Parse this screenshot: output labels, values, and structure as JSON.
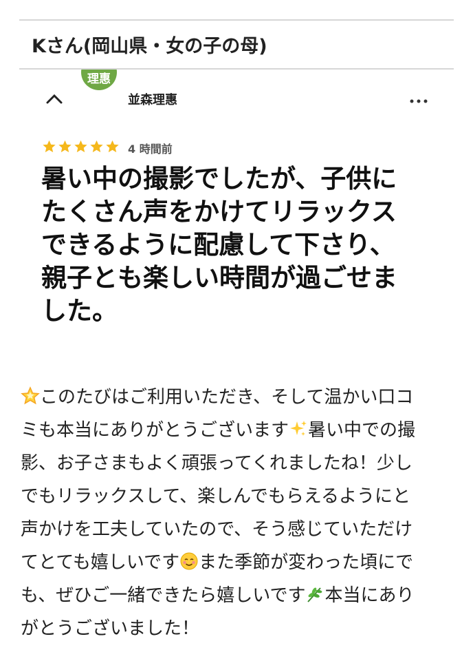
{
  "header": {
    "title": "Kさん(岡山県・女の子の母)"
  },
  "review_app": {
    "avatar_text": "理惠",
    "reviewer_name": "並森理惠",
    "icons": {
      "close": "close-icon",
      "more": "more-dots-icon"
    }
  },
  "review": {
    "rating": 5,
    "time_ago": "4 時間前",
    "lines": [
      "暑い中の撮影でしたが、子供に",
      "たくさん声をかけてリラックス",
      "できるように配慮して下さり、",
      "親子とも楽しい時間が過ごせま",
      "した。"
    ]
  },
  "reply": {
    "line1": "このたびはご利用いただき、そして温かい口コ",
    "line2_a": "ミも本当にありがとうございます",
    "line2_b": "暑い中での撮",
    "line3": "影、お子さまもよく頑張ってくれましたね！少し",
    "line4": "でもリラックスして、楽しんでもらえるようにと",
    "line5": "声かけを工夫していたので、そう感じていただけ",
    "line6_a": "てとても嬉しいです",
    "line6_b": "また季節が変わった頃にで",
    "line7_a": "も、ぜひご一緒できたら嬉しいです",
    "line7_b": "本当にあり",
    "line8": "がとうございました！",
    "emojis": [
      "glowing-star",
      "sparkles",
      "smiling-face",
      "herb"
    ]
  },
  "colors": {
    "star": "#f5b81c",
    "avatar": "#6fa845",
    "rule": "#d6d6d6"
  }
}
